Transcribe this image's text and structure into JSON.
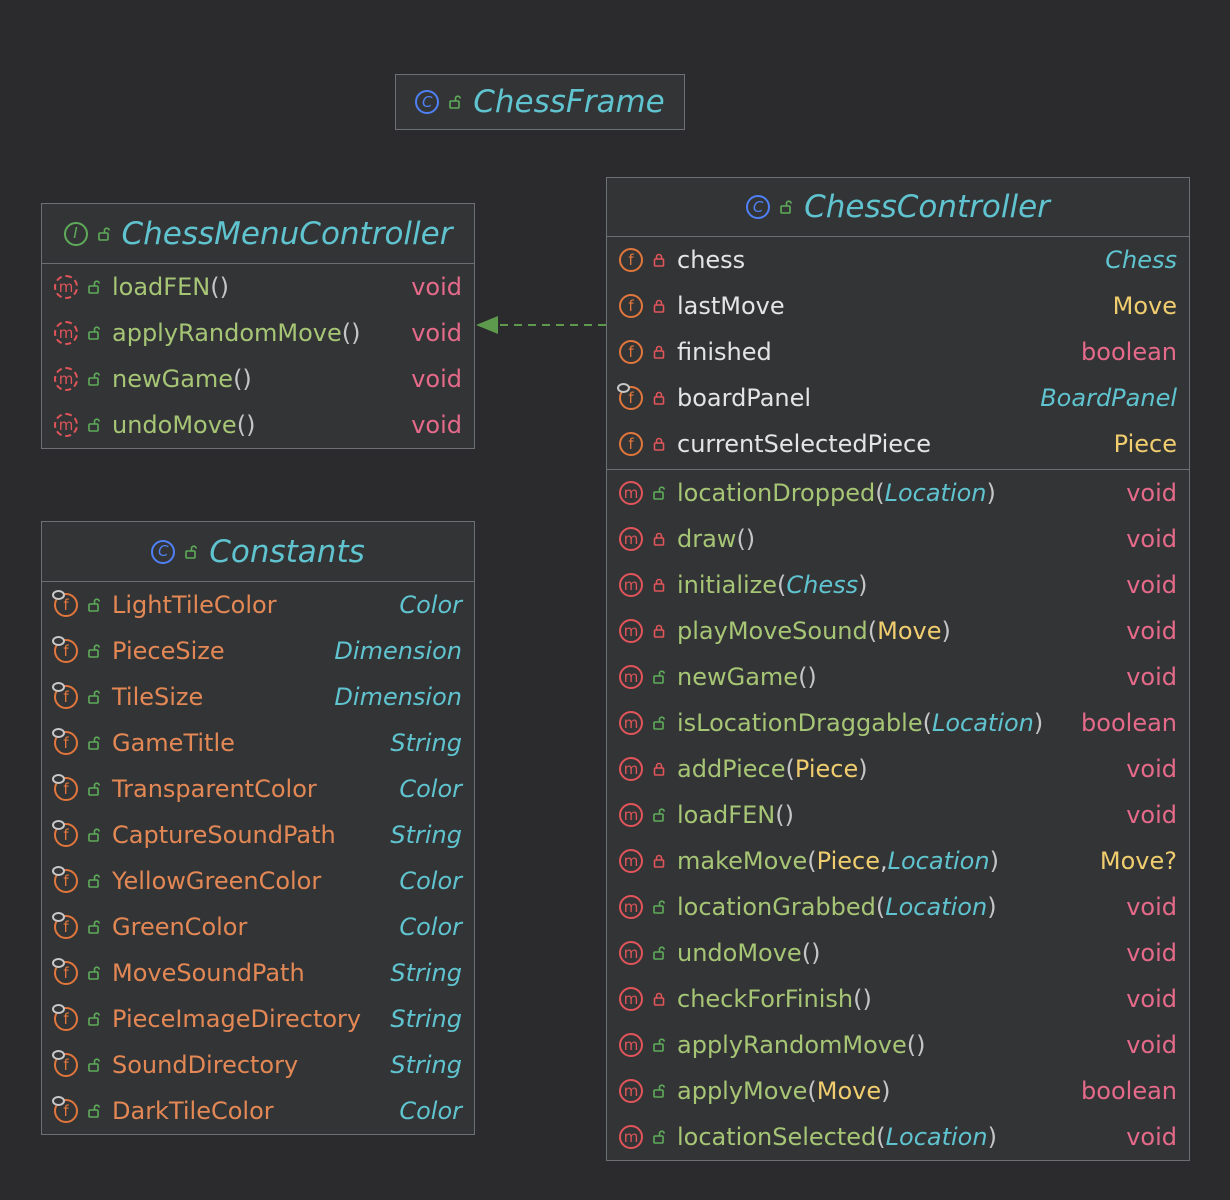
{
  "chess_frame": {
    "icon": "class-icon",
    "title": "ChessFrame"
  },
  "chess_menu_controller": {
    "icon": "interface-icon",
    "title": "ChessMenuController",
    "methods": [
      {
        "name": "loadFEN",
        "params": "()",
        "type": "void"
      },
      {
        "name": "applyRandomMove",
        "params": "()",
        "type": "void"
      },
      {
        "name": "newGame",
        "params": "()",
        "type": "void"
      },
      {
        "name": "undoMove",
        "params": "()",
        "type": "void"
      }
    ]
  },
  "constants": {
    "icon": "class-icon",
    "title": "Constants",
    "fields": [
      {
        "name": "LightTileColor",
        "type": "Color"
      },
      {
        "name": "PieceSize",
        "type": "Dimension"
      },
      {
        "name": "TileSize",
        "type": "Dimension"
      },
      {
        "name": "GameTitle",
        "type": "String"
      },
      {
        "name": "TransparentColor",
        "type": "Color"
      },
      {
        "name": "CaptureSoundPath",
        "type": "String"
      },
      {
        "name": "YellowGreenColor",
        "type": "Color"
      },
      {
        "name": "GreenColor",
        "type": "Color"
      },
      {
        "name": "MoveSoundPath",
        "type": "String"
      },
      {
        "name": "PieceImageDirectory",
        "type": "String"
      },
      {
        "name": "SoundDirectory",
        "type": "String"
      },
      {
        "name": "DarkTileColor",
        "type": "Color"
      }
    ]
  },
  "chess_controller": {
    "icon": "class-icon",
    "title": "ChessController",
    "fields": [
      {
        "name": "chess",
        "type": "Chess"
      },
      {
        "name": "lastMove",
        "type": "Move"
      },
      {
        "name": "finished",
        "type": "boolean"
      },
      {
        "name": "boardPanel",
        "type": "BoardPanel"
      },
      {
        "name": "currentSelectedPiece",
        "type": "Piece"
      }
    ],
    "methods": [
      {
        "name": "locationDropped",
        "p_open": "(",
        "p1": "Location",
        "p_sep": "",
        "p2": "",
        "p_close": ")",
        "type": "void"
      },
      {
        "name": "draw",
        "p_open": "()",
        "p1": "",
        "p_sep": "",
        "p2": "",
        "p_close": "",
        "type": "void"
      },
      {
        "name": "initialize",
        "p_open": "(",
        "p1": "Chess",
        "p_sep": "",
        "p2": "",
        "p_close": ")",
        "type": "void"
      },
      {
        "name": "playMoveSound",
        "p_open": "(",
        "p1": "Move",
        "p_sep": "",
        "p2": "",
        "p_close": ")",
        "type": "void"
      },
      {
        "name": "newGame",
        "p_open": "()",
        "p1": "",
        "p_sep": "",
        "p2": "",
        "p_close": "",
        "type": "void"
      },
      {
        "name": "isLocationDraggable",
        "p_open": "(",
        "p1": "Location",
        "p_sep": "",
        "p2": "",
        "p_close": ")",
        "type": "boolean"
      },
      {
        "name": "addPiece",
        "p_open": "(",
        "p1": "Piece",
        "p_sep": "",
        "p2": "",
        "p_close": ")",
        "type": "void"
      },
      {
        "name": "loadFEN",
        "p_open": "()",
        "p1": "",
        "p_sep": "",
        "p2": "",
        "p_close": "",
        "type": "void"
      },
      {
        "name": "makeMove",
        "p_open": "(",
        "p1": "Piece",
        "p_sep": ", ",
        "p2": "Location",
        "p_close": ")",
        "type": "Move?"
      },
      {
        "name": "locationGrabbed",
        "p_open": "(",
        "p1": "Location",
        "p_sep": "",
        "p2": "",
        "p_close": ")",
        "type": "void"
      },
      {
        "name": "undoMove",
        "p_open": "()",
        "p1": "",
        "p_sep": "",
        "p2": "",
        "p_close": "",
        "type": "void"
      },
      {
        "name": "checkForFinish",
        "p_open": "()",
        "p1": "",
        "p_sep": "",
        "p2": "",
        "p_close": "",
        "type": "void"
      },
      {
        "name": "applyRandomMove",
        "p_open": "()",
        "p1": "",
        "p_sep": "",
        "p2": "",
        "p_close": "",
        "type": "void"
      },
      {
        "name": "applyMove",
        "p_open": "(",
        "p1": "Move",
        "p_sep": "",
        "p2": "",
        "p_close": ")",
        "type": "boolean"
      },
      {
        "name": "locationSelected",
        "p_open": "(",
        "p1": "Location",
        "p_sep": "",
        "p2": "",
        "p_close": ")",
        "type": "void"
      }
    ]
  },
  "icon_letters": {
    "class": "C",
    "interface": "I",
    "method": "m",
    "field": "f"
  },
  "colors": {
    "background": "#2b2b2d",
    "box": "#333436",
    "border": "#6c6f74",
    "title": "#5fc4cf",
    "method_name": "#a6c575",
    "field_name": "#e4e4e4",
    "constant_name": "#e38855",
    "void_type": "#e56a8a",
    "move_piece_type": "#f0cd6e",
    "arrow": "#5e9a4d"
  }
}
